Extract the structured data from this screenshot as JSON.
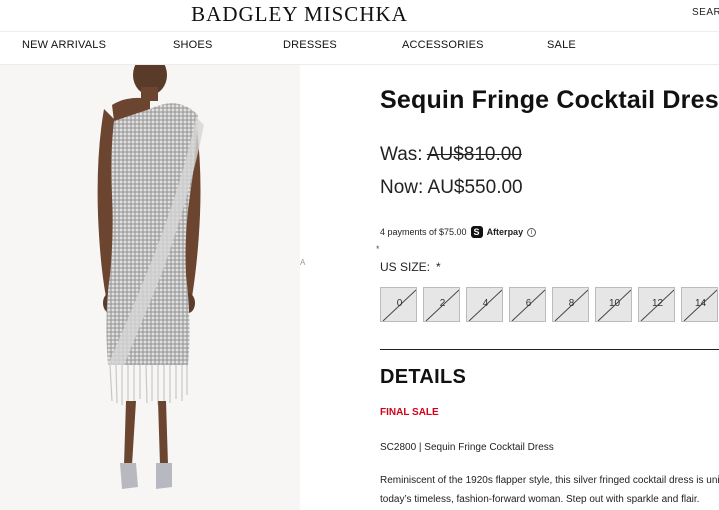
{
  "header": {
    "logo": "BADGLEY MISCHKA",
    "search_label": "SEAR"
  },
  "nav": {
    "items": [
      {
        "label": "NEW ARRIVALS"
      },
      {
        "label": "SHOES"
      },
      {
        "label": "DRESSES"
      },
      {
        "label": "ACCESSORIES"
      },
      {
        "label": "SALE"
      }
    ]
  },
  "gallery": {
    "thumb_hint": "A",
    "thumb_marker": "*"
  },
  "product": {
    "title": "Sequin Fringe Cocktail Dress",
    "was_label": "Was:",
    "was_price": "AU$810.00",
    "now_label": "Now:",
    "now_price": "AU$550.00",
    "afterpay": {
      "text": "4 payments of $75.00",
      "logo_glyph": "S",
      "brand": "Afterpay",
      "info_icon": "info-icon"
    },
    "size_label": "US SIZE:",
    "size_required": "*",
    "sizes": [
      "0",
      "2",
      "4",
      "6",
      "8",
      "10",
      "12",
      "14"
    ],
    "sizes_unavailable": true,
    "details_heading": "DETAILS",
    "final_sale": "FINAL SALE",
    "sku_line": "SC2800 | Sequin Fringe Cocktail Dress",
    "description": [
      "Reminiscent of the 1920s flapper style, this silver fringed cocktail dress is uni",
      "today’s timeless, fashion-forward woman. Step out with sparkle and flair."
    ]
  },
  "colors": {
    "sale_red": "#d0021b",
    "size_disabled_bg": "#e6e6e6",
    "image_bg": "#f7f6f4"
  }
}
